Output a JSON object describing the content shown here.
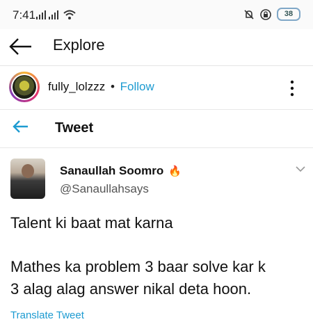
{
  "status_bar": {
    "time": "7:41",
    "battery": "38"
  },
  "app_bar": {
    "title": "Explore"
  },
  "profile": {
    "username": "fully_lolzzz",
    "separator": "•",
    "follow_label": "Follow"
  },
  "tweet_header": {
    "title": "Tweet"
  },
  "tweet": {
    "author_name": "Sanaullah Soomro",
    "author_emoji": "🔥",
    "handle": "@Sanaullahsays",
    "line1": "Talent ki baat mat karna",
    "line2": "Mathes ka problem 3 baar solve kar k",
    "line3": "3 alag alag answer nikal deta hoon.",
    "translate_label": "Translate Tweet"
  },
  "colors": {
    "accent": "#1d9bd1",
    "text": "#111111",
    "muted": "#555555"
  }
}
